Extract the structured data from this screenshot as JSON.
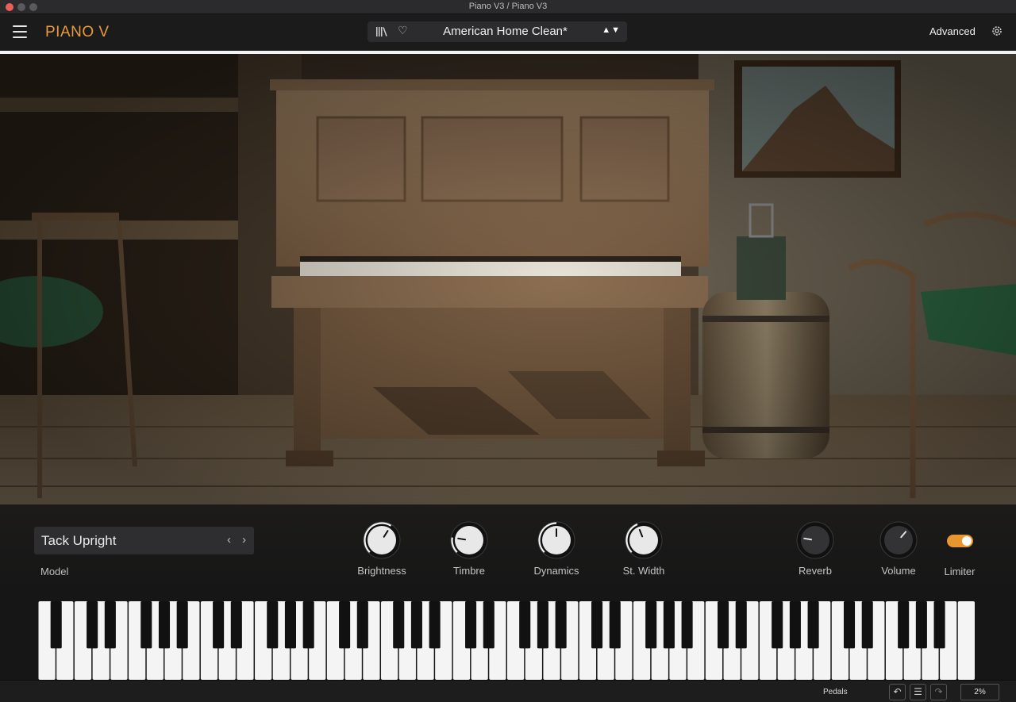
{
  "window": {
    "title": "Piano V3 / Piano V3"
  },
  "header": {
    "app_name": "PIANO V",
    "preset_name": "American Home Clean*",
    "preset_arrows": "▲▼",
    "advanced_label": "Advanced"
  },
  "model": {
    "name": "Tack Upright",
    "label": "Model",
    "prev": "‹",
    "next": "›"
  },
  "knobs": [
    {
      "label": "Brightness",
      "value": 0.62
    },
    {
      "label": "Timbre",
      "value": 0.2
    },
    {
      "label": "Dynamics",
      "value": 0.5
    },
    {
      "label": "St. Width",
      "value": 0.42
    },
    {
      "label": "Reverb",
      "value": 0.2
    },
    {
      "label": "Volume",
      "value": 0.65
    }
  ],
  "limiter": {
    "label": "Limiter",
    "on": true
  },
  "statusbar": {
    "pedals_label": "Pedals",
    "undo": "↶",
    "history": "☰",
    "redo": "↷",
    "cpu": "2%"
  },
  "colors": {
    "accent": "#e99b3c",
    "toggle": "#e8962f"
  },
  "icons": [
    "menu-icon",
    "library-icon",
    "heart-icon",
    "gear-icon",
    "undo-icon",
    "history-icon",
    "redo-icon"
  ]
}
